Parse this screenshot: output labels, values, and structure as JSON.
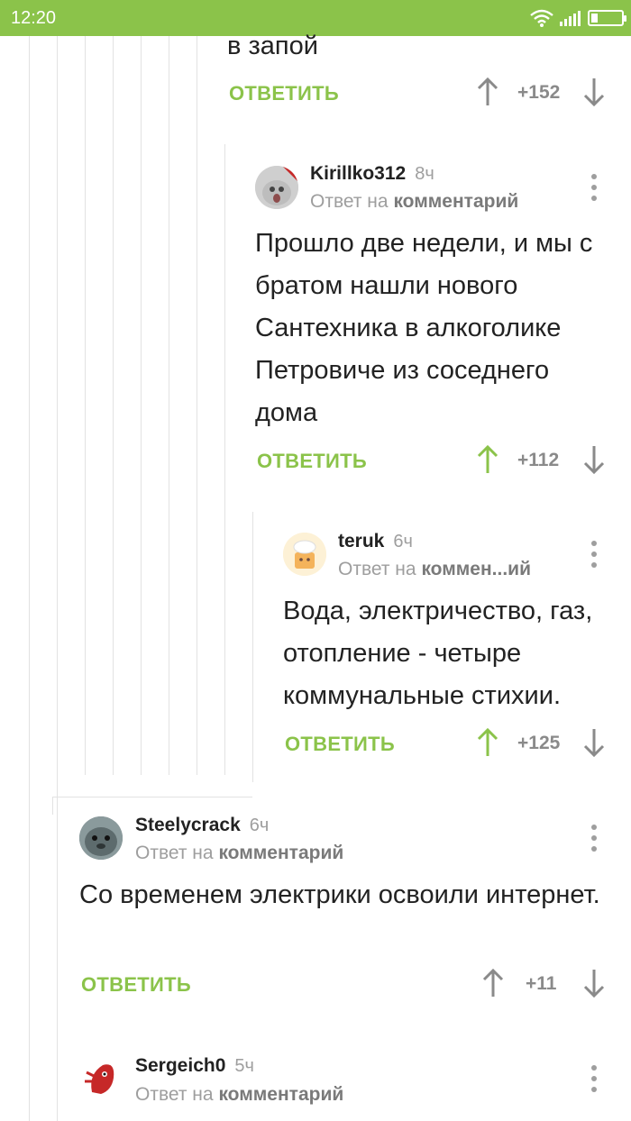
{
  "status_bar": {
    "time": "12:20"
  },
  "comments": [
    {
      "body": "в запой",
      "reply_label": "ОТВЕТИТЬ",
      "score": "+152"
    },
    {
      "username": "Kirillko312",
      "time": "8ч",
      "reply_prefix": "Ответ на",
      "reply_target": "комментарий",
      "body": "Прошло две недели, и мы с братом нашли нового Сантехника в алкоголике Петровиче из соседнего дома",
      "reply_label": "ОТВЕТИТЬ",
      "score": "+112"
    },
    {
      "username": "teruk",
      "time": "6ч",
      "reply_prefix": "Ответ на",
      "reply_target": "коммен...ий",
      "body": "Вода, электричество, газ, отопление - четыре коммунальные стихии.",
      "reply_label": "ОТВЕТИТЬ",
      "score": "+125"
    },
    {
      "username": "Steelycrack",
      "time": "6ч",
      "reply_prefix": "Ответ на",
      "reply_target": "комментарий",
      "body": "Со временем электрики освоили интернет.",
      "reply_label": "ОТВЕТИТЬ",
      "score": "+11"
    },
    {
      "username": "Sergeich0",
      "time": "5ч",
      "reply_prefix": "Ответ на",
      "reply_target": "комментарий"
    }
  ],
  "colors": {
    "accent": "#8bc34a",
    "muted": "#9e9e9e",
    "text": "#222222"
  },
  "icons": [
    "wifi-icon",
    "signal-icon",
    "battery-icon",
    "upvote-icon",
    "downvote-icon",
    "more-icon"
  ]
}
